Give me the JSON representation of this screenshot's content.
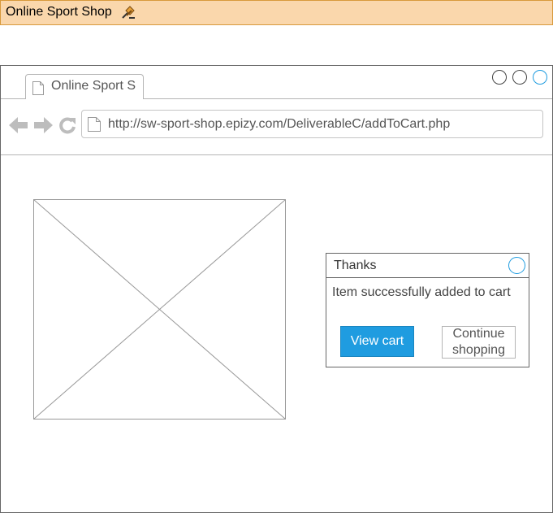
{
  "app": {
    "title": "Online Sport Shop",
    "accent_color": "#fad7ac"
  },
  "browser": {
    "tab_title": "Online Sport S",
    "url": "http://sw-sport-shop.epizy.com/DeliverableC/addToCart.php",
    "window_controls": [
      "minimize",
      "maximize",
      "close"
    ]
  },
  "dialog": {
    "title": "Thanks",
    "message": "Item successfully added to cart",
    "primary_button": "View cart",
    "secondary_button": "Continue shopping",
    "primary_color": "#1f9ce0"
  }
}
